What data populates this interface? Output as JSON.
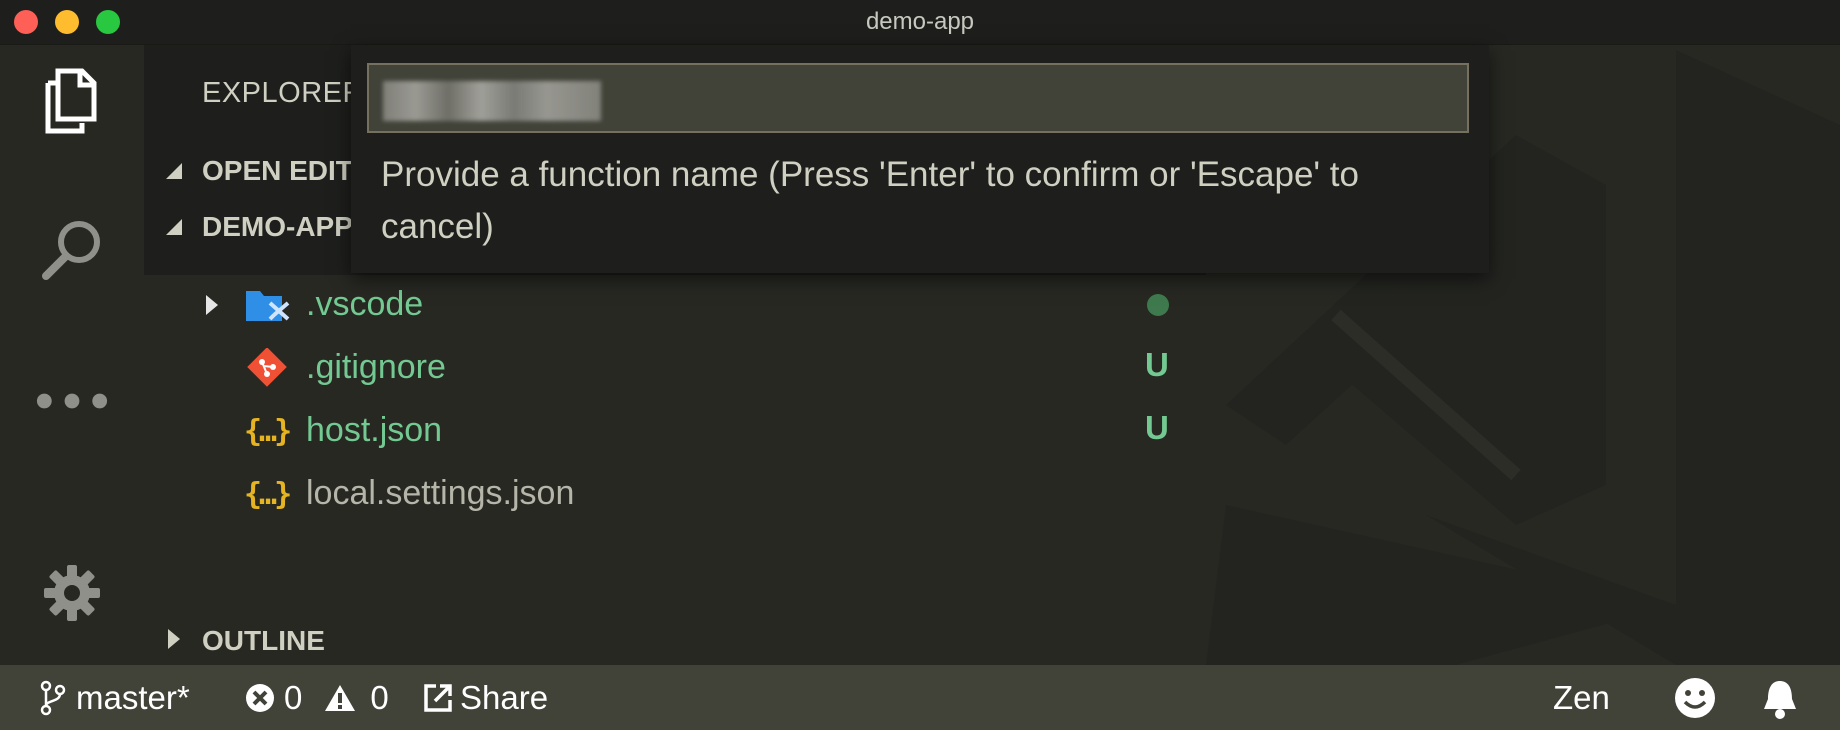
{
  "window": {
    "title": "demo-app"
  },
  "activity_bar": {
    "items": [
      {
        "icon": "files-icon"
      },
      {
        "icon": "search-icon"
      },
      {
        "icon": "more-icon"
      },
      {
        "icon": "gear-icon"
      }
    ]
  },
  "sidebar": {
    "header": "EXPLORER",
    "open_editors": "OPEN EDITORS",
    "project": "DEMO-APP",
    "outline": "OUTLINE",
    "files": [
      {
        "name": ".vscode",
        "status": "",
        "icon": "vscode-folder-icon"
      },
      {
        "name": ".gitignore",
        "status": "U",
        "icon": "git-icon"
      },
      {
        "name": "host.json",
        "status": "U",
        "icon": "json-icon"
      },
      {
        "name": "local.settings.json",
        "status": "",
        "icon": "json-icon"
      }
    ]
  },
  "quick_input": {
    "value": "",
    "message": "Provide a function name (Press 'Enter' to confirm or 'Escape' to cancel)"
  },
  "statusbar": {
    "branch": "master*",
    "errors": "0",
    "warnings": "0",
    "share": "Share",
    "zen": "Zen"
  },
  "colors": {
    "accent_green": "#73c991",
    "json_yellow": "#e6b422",
    "git_orange": "#f05033",
    "vscode_blue": "#2f8ee6"
  }
}
